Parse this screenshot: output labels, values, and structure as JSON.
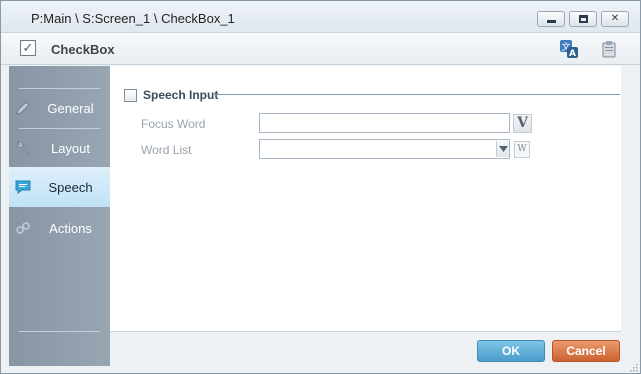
{
  "window": {
    "title": "P:Main \\ S:Screen_1 \\ CheckBox_1"
  },
  "header": {
    "title": "CheckBox",
    "icon": "checkbox-icon",
    "tools": [
      "translate-icon",
      "clipboard-icon"
    ]
  },
  "sidebar": {
    "items": [
      {
        "label": "General",
        "icon": "pencil-icon",
        "active": false
      },
      {
        "label": "Layout",
        "icon": "wrench-icon",
        "active": false
      },
      {
        "label": "Speech",
        "icon": "speech-bubble-icon",
        "active": true
      },
      {
        "label": "Actions",
        "icon": "actions-icon",
        "active": false
      }
    ]
  },
  "speech": {
    "group_title": "Speech Input",
    "group_checked": false,
    "focus_word_label": "Focus Word",
    "focus_word_value": "",
    "focus_word_button": "V",
    "word_list_label": "Word List",
    "word_list_value": "",
    "word_list_button": "W"
  },
  "footer": {
    "ok_label": "OK",
    "cancel_label": "Cancel"
  },
  "colors": {
    "sidebar_bg": "#8f9dab",
    "sidebar_active": "#cfe9f8",
    "ok_button": "#5aa9d6",
    "cancel_button": "#d9713f",
    "group_line": "#7f9bb5"
  }
}
